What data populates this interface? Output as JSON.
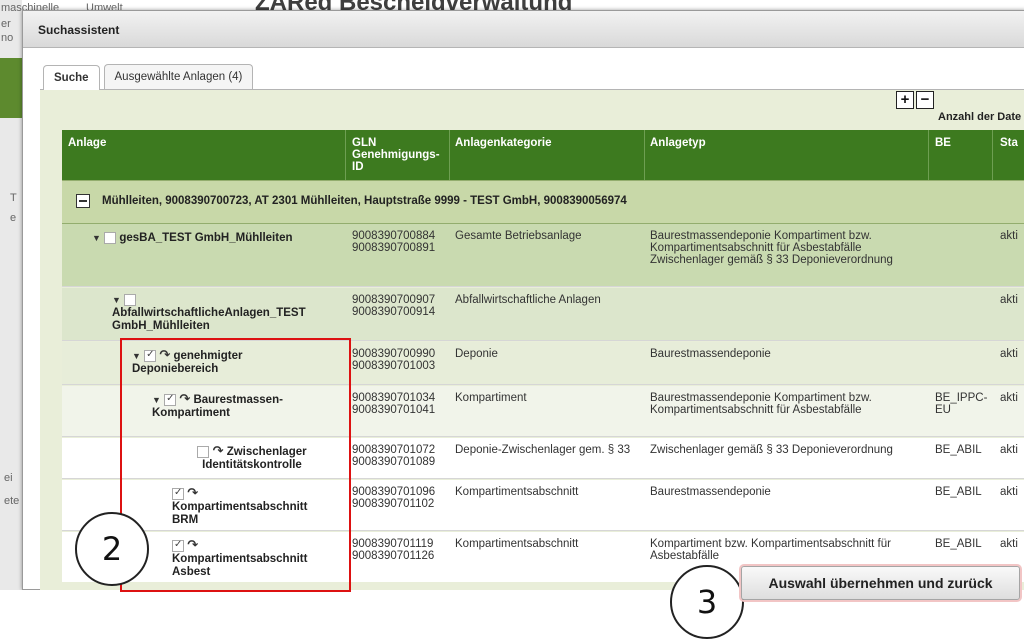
{
  "background": {
    "title": "ZAReg Bescheidverwaltung",
    "fragments": [
      "maschinelle",
      "Umwelt",
      "er",
      "no",
      "T",
      "e",
      "ei",
      "ete"
    ]
  },
  "dialog": {
    "title": "Suchassistent",
    "tabs": [
      {
        "label": "Suche",
        "active": true
      },
      {
        "label": "Ausgewählte Anlagen (4)",
        "active": false
      }
    ],
    "toolbar": {
      "expand_icon": "plus-square-icon",
      "collapse_icon": "minus-square-icon",
      "anzahl_label": "Anzahl der Date"
    }
  },
  "table": {
    "columns": [
      "Anlage",
      "GLN Genehmigungs-ID",
      "Anlagenkategorie",
      "Anlagetyp",
      "BE",
      "Sta"
    ],
    "group": {
      "label": "Mühlleiten, 9008390700723, AT 2301 Mühlleiten, Hauptstraße 9999 - TEST GmbH, 9008390056974"
    },
    "rows": [
      {
        "name": "gesBA_TEST GmbH_Mühlleiten",
        "gln": "9008390700884 9008390700891",
        "kategorie": "Gesamte Betriebsanlage",
        "typ": "Baurestmassendeponie Kompartiment bzw. Kompartimentsabschnitt für Asbestabfälle Zwischenlager gemäß § 33 Deponieverordnung",
        "be": "",
        "status": "akti"
      },
      {
        "name": "AbfallwirtschaftlicheAnlagen_TEST GmbH_Mühlleiten",
        "gln": "9008390700907 9008390700914",
        "kategorie": "Abfallwirtschaftliche Anlagen",
        "typ": "",
        "be": "",
        "status": "akti"
      },
      {
        "name": "genehmigter Deponiebereich",
        "gln": "9008390700990 9008390701003",
        "kategorie": "Deponie",
        "typ": "Baurestmassendeponie",
        "be": "",
        "status": "akti"
      },
      {
        "name": "Baurestmassen-Kompartiment",
        "gln": "9008390701034 9008390701041",
        "kategorie": "Kompartiment",
        "typ": "Baurestmassendeponie Kompartiment bzw. Kompartimentsabschnitt für Asbestabfälle",
        "be": "BE_IPPC-EU",
        "status": "akti"
      },
      {
        "name": "Zwischenlager Identitätskontrolle",
        "gln": "9008390701072 9008390701089",
        "kategorie": "Deponie-Zwischenlager gem. § 33",
        "typ": "Zwischenlager gemäß § 33 Deponieverordnung",
        "be": "BE_ABIL",
        "status": "akti"
      },
      {
        "name": "Kompartimentsabschnitt BRM",
        "gln": "9008390701096 9008390701102",
        "kategorie": "Kompartimentsabschnitt",
        "typ": "Baurestmassendeponie",
        "be": "BE_ABIL",
        "status": "akti"
      },
      {
        "name": "Kompartimentsabschnitt Asbest",
        "gln": "9008390701119 9008390701126",
        "kategorie": "Kompartimentsabschnitt",
        "typ": "Kompartiment bzw. Kompartimentsabschnitt für Asbestabfälle",
        "be": "BE_ABIL",
        "status": "akti"
      }
    ]
  },
  "annotations": {
    "circle_2": "2",
    "circle_3": "3"
  },
  "confirm_button": "Auswahl übernehmen und zurück"
}
